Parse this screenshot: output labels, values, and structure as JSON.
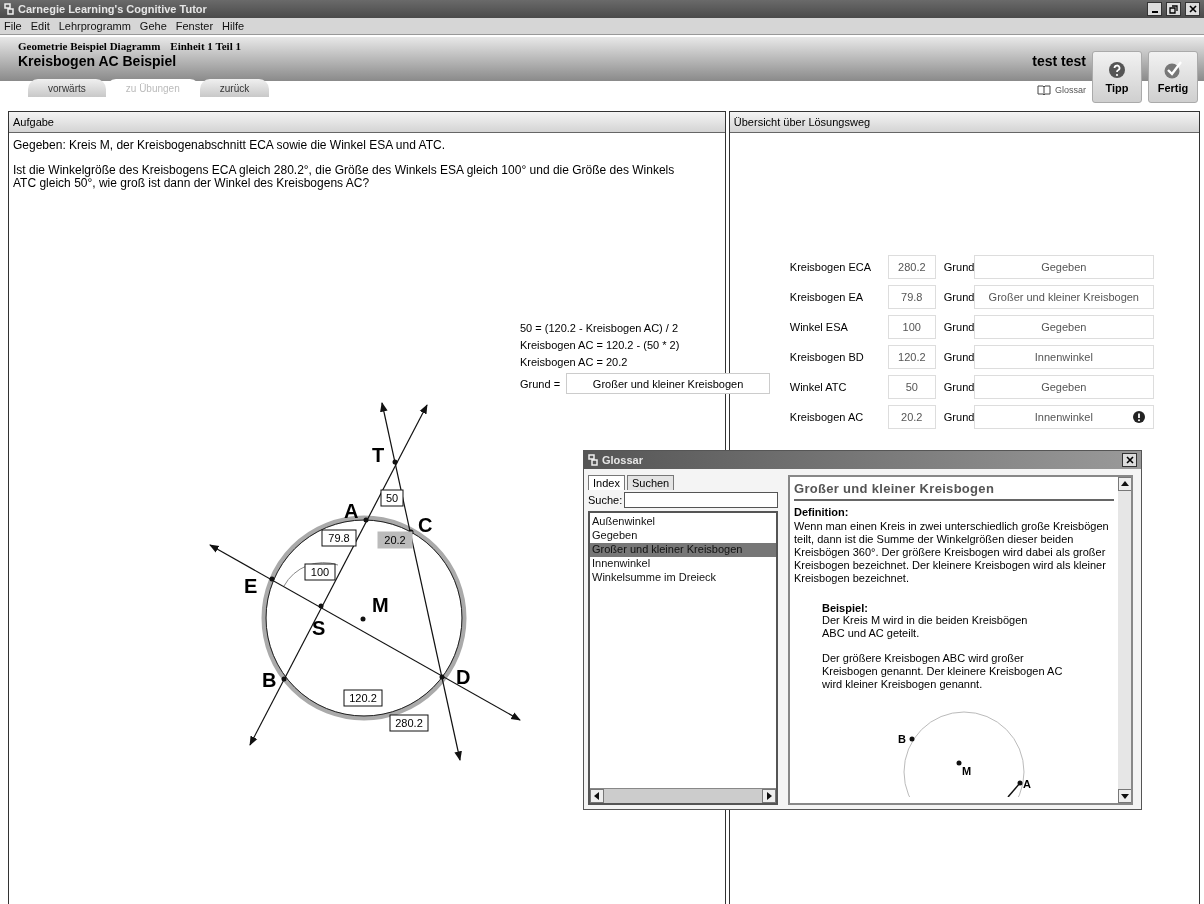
{
  "window": {
    "title": "Carnegie Learning's Cognitive Tutor"
  },
  "menu": [
    "File",
    "Edit",
    "Lehrprogramm",
    "Gehe",
    "Fenster",
    "Hilfe"
  ],
  "header": {
    "course": "Geometrie Beispiel Diagramm",
    "unit": "Einheit 1 Teil 1",
    "lesson": "Kreisbogen AC Beispiel",
    "user": "test test"
  },
  "nav_tabs": [
    {
      "label": "vorwärts",
      "selected": false
    },
    {
      "label": "zu Übungen",
      "selected": true
    },
    {
      "label": "zurück",
      "selected": false
    }
  ],
  "glossary_link": "Glossar",
  "buttons": [
    {
      "kind": "hint",
      "label": "Tipp"
    },
    {
      "kind": "done",
      "label": "Fertig"
    }
  ],
  "problem": {
    "title": "Aufgabe",
    "paragraphs": [
      "Gegeben: Kreis M, der Kreisbogenabschnitt ECA sowie die Winkel ESA und ATC.",
      "Ist die Winkelgröße des Kreisbogens ECA gleich 280.2°, die Größe des Winkels ESA gleich 100° und die Größe des Winkels ATC gleich 50°, wie groß ist dann der Winkel des Kreisbogens AC?"
    ]
  },
  "working": {
    "lines": [
      "50 = (120.2 - Kreisbogen AC) / 2",
      "Kreisbogen AC = 120.2 - (50 * 2)",
      "Kreisbogen AC = 20.2"
    ],
    "reason_label": "Grund =",
    "reason": "Großer und kleiner Kreisbogen"
  },
  "diagram": {
    "points": [
      "T",
      "A",
      "C",
      "E",
      "S",
      "B",
      "D",
      "M"
    ],
    "measures": [
      {
        "text": "50",
        "highlighted": false
      },
      {
        "text": "79.8",
        "highlighted": false
      },
      {
        "text": "20.2",
        "highlighted": true
      },
      {
        "text": "100",
        "highlighted": false
      },
      {
        "text": "120.2",
        "highlighted": false
      },
      {
        "text": "280.2",
        "highlighted": false
      }
    ]
  },
  "summary": {
    "title": "Übersicht über Lösungsweg",
    "rows": [
      {
        "label": "Kreisbogen ECA",
        "value": "280.2",
        "reason_label": "Grund",
        "reason": "Gegeben",
        "flagged": false
      },
      {
        "label": "Kreisbogen EA",
        "value": "79.8",
        "reason_label": "Grund",
        "reason": "Großer und kleiner Kreisbogen",
        "flagged": false
      },
      {
        "label": "Winkel ESA",
        "value": "100",
        "reason_label": "Grund",
        "reason": "Gegeben",
        "flagged": false
      },
      {
        "label": "Kreisbogen BD",
        "value": "120.2",
        "reason_label": "Grund",
        "reason": "Innenwinkel",
        "flagged": false
      },
      {
        "label": "Winkel ATC",
        "value": "50",
        "reason_label": "Grund",
        "reason": "Gegeben",
        "flagged": false
      },
      {
        "label": "Kreisbogen AC",
        "value": "20.2",
        "reason_label": "Grund",
        "reason": "Innenwinkel",
        "flagged": true
      }
    ]
  },
  "glossary": {
    "title": "Glossar",
    "tabs": [
      {
        "label": "Index",
        "selected": true
      },
      {
        "label": "Suchen",
        "selected": false
      }
    ],
    "search_label": "Suche:",
    "items": [
      {
        "label": "Außenwinkel",
        "selected": false
      },
      {
        "label": "Gegeben",
        "selected": false
      },
      {
        "label": "Großer und kleiner Kreisbogen",
        "selected": true
      },
      {
        "label": "Innenwinkel",
        "selected": false
      },
      {
        "label": "Winkelsumme im Dreieck",
        "selected": false
      }
    ],
    "entry_title": "Großer und kleiner Kreisbogen",
    "definition_heading": "Definition:",
    "definition": "Wenn man einen Kreis in zwei unterschiedlich große Kreisbögen teilt, dann ist die Summe der Winkelgrößen dieser beiden Kreisbögen 360°. Der größere Kreisbogen wird dabei als großer Kreisbogen bezeichnet. Der kleinere Kreisbogen wird als kleiner Kreisbogen bezeichnet.",
    "example_heading": "Beispiel:",
    "example": [
      "Der Kreis M wird in die beiden Kreisbögen ABC und AC geteilt.",
      "Der größere Kreisbogen ABC wird großer Kreisbogen genannt. Der kleinere Kreisbogen AC wird kleiner Kreisbogen genannt."
    ],
    "example_points": [
      "B",
      "M",
      "A"
    ]
  }
}
